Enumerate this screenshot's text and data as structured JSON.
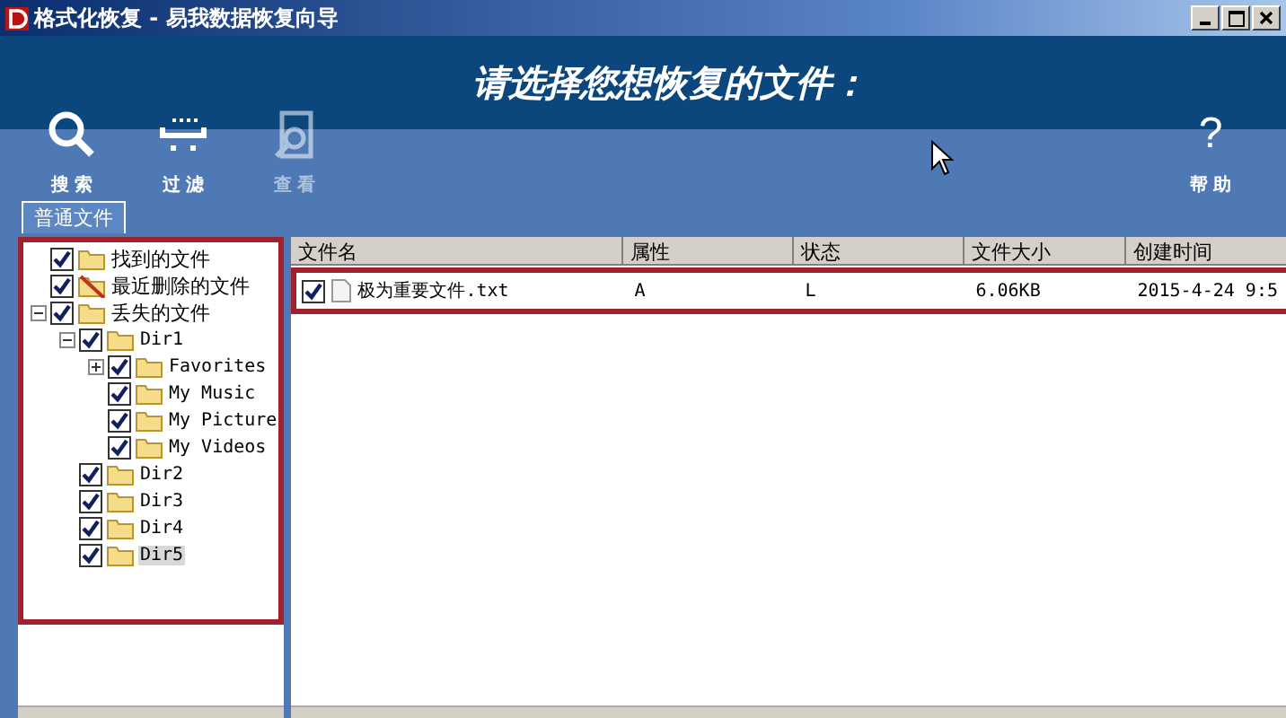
{
  "window": {
    "title": "格式化恢复 - 易我数据恢复向导"
  },
  "heading": "请选择您想恢复的文件：",
  "toolbar": [
    {
      "kind": "search",
      "label": "搜 索",
      "disabled": false
    },
    {
      "kind": "filter",
      "label": "过 滤",
      "disabled": false
    },
    {
      "kind": "view",
      "label": "查 看",
      "disabled": true
    }
  ],
  "help": {
    "symbol": "?",
    "label": "帮 助"
  },
  "tabs": [
    {
      "label": "普通文件",
      "selected": true
    }
  ],
  "tree": [
    {
      "label": "找到的文件",
      "checked": true,
      "kind": "folder",
      "selected": false
    },
    {
      "label": "最近删除的文件",
      "checked": true,
      "kind": "deleted",
      "selected": false
    },
    {
      "label": "丢失的文件",
      "checked": true,
      "kind": "folder",
      "selected": false,
      "expanded": true,
      "children": [
        {
          "label": "Dir1",
          "checked": true,
          "kind": "folder",
          "selected": false,
          "expanded": true,
          "children": [
            {
              "label": "Favorites",
              "checked": true,
              "kind": "folder",
              "selected": false,
              "expanded": false
            },
            {
              "label": "My Music",
              "checked": true,
              "kind": "folder",
              "selected": false
            },
            {
              "label": "My Picture",
              "checked": true,
              "kind": "folder",
              "selected": false
            },
            {
              "label": "My Videos",
              "checked": true,
              "kind": "folder",
              "selected": false
            }
          ]
        },
        {
          "label": "Dir2",
          "checked": true,
          "kind": "folder",
          "selected": false
        },
        {
          "label": "Dir3",
          "checked": true,
          "kind": "folder",
          "selected": false
        },
        {
          "label": "Dir4",
          "checked": true,
          "kind": "folder",
          "selected": false
        },
        {
          "label": "Dir5",
          "checked": true,
          "kind": "folder",
          "selected": true
        }
      ]
    }
  ],
  "table": {
    "columns": [
      "文件名",
      "属性",
      "状态",
      "文件大小",
      "创建时间"
    ],
    "rows": [
      {
        "checked": true,
        "cells": [
          "极为重要文件.txt",
          "A",
          "L",
          "6.06KB",
          "2015-4-24 9:5"
        ]
      }
    ]
  }
}
